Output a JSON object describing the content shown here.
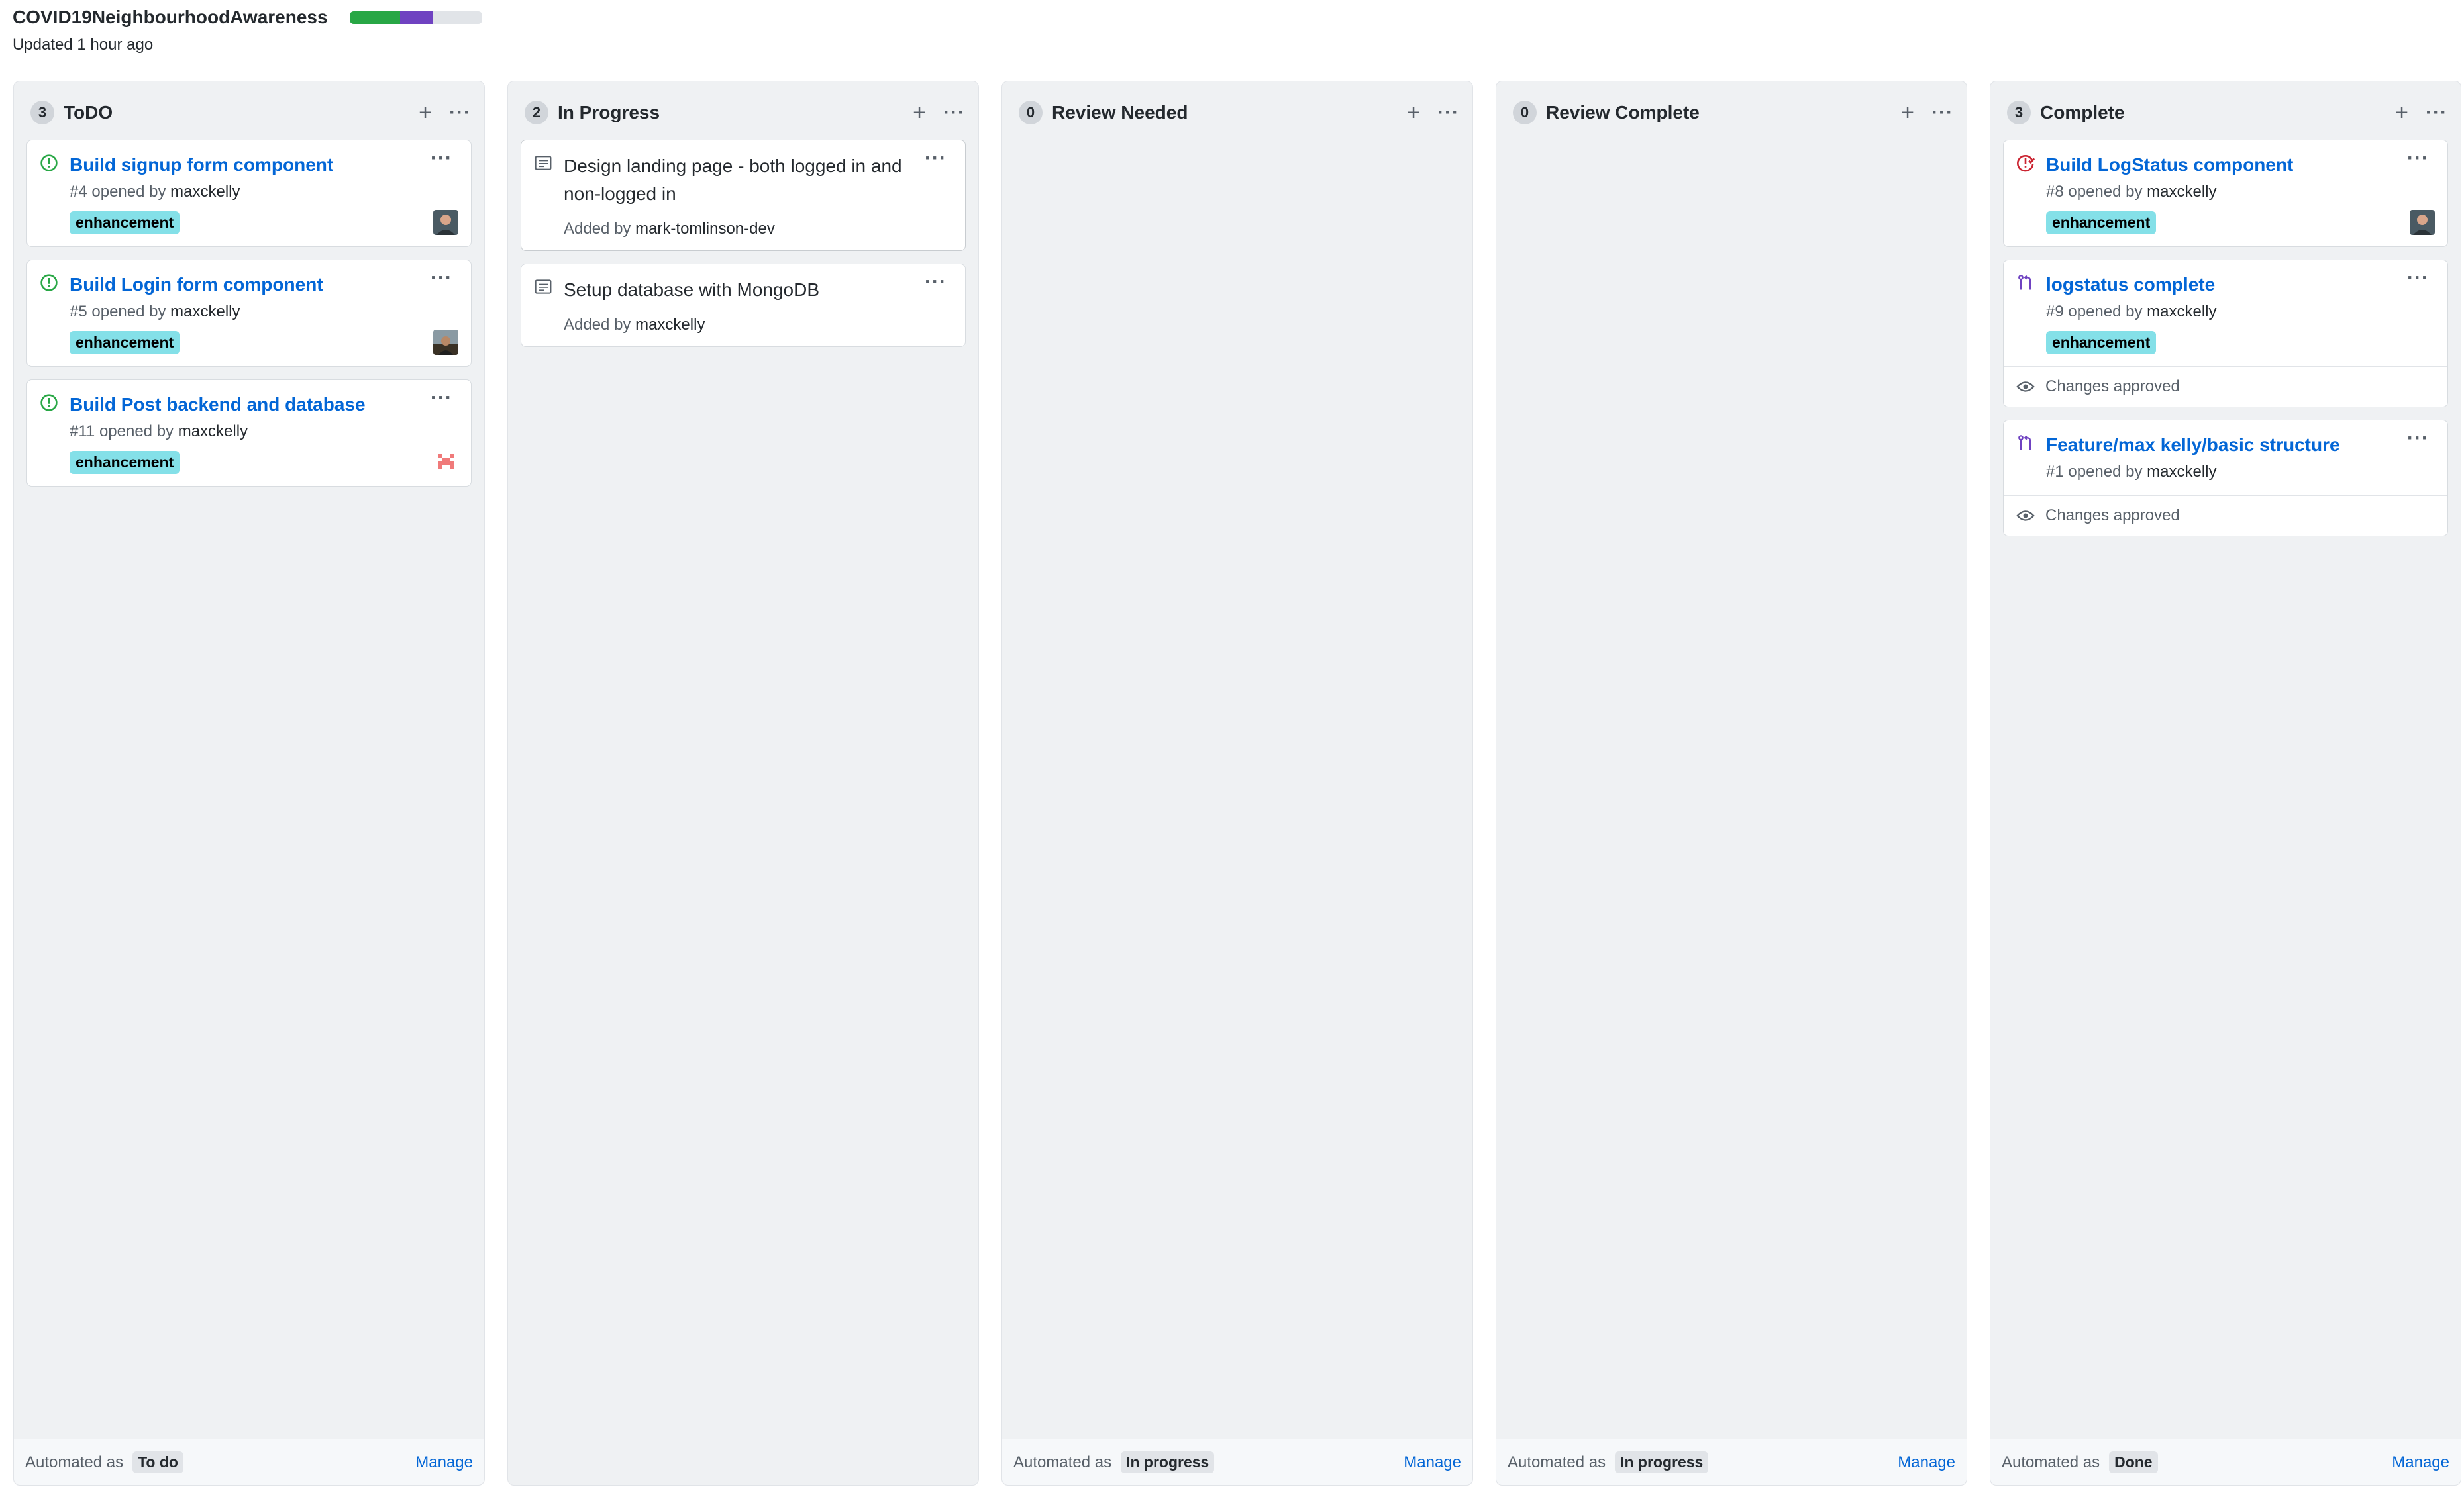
{
  "board": {
    "title": "COVID19NeighbourhoodAwareness",
    "updated": "Updated 1 hour ago",
    "progress": [
      {
        "color": "#28a745",
        "fraction": 0.38
      },
      {
        "color": "#6f42c1",
        "fraction": 0.25
      }
    ]
  },
  "colors": {
    "link": "#0366d6",
    "issue_open": "#28a745",
    "issue_closed": "#cb2431",
    "pr_merged": "#6f42c1",
    "label_bg": "#84e0e8"
  },
  "columns": [
    {
      "count": "3",
      "title": "ToDO",
      "automated_label": "Automated as",
      "automated_value": "To do",
      "manage": "Manage",
      "cards": [
        {
          "type": "issue-open",
          "icon": "issue-opened-icon",
          "title": "Build signup form component",
          "number": "#4",
          "opened_by": "opened by",
          "author": "maxckelly",
          "label": "enhancement",
          "avatar": "avatar-1"
        },
        {
          "type": "issue-open",
          "icon": "issue-opened-icon",
          "title": "Build Login form component",
          "number": "#5",
          "opened_by": "opened by",
          "author": "maxckelly",
          "label": "enhancement",
          "avatar": "avatar-2"
        },
        {
          "type": "issue-open",
          "icon": "issue-opened-icon",
          "title": "Build Post backend and database",
          "number": "#11",
          "opened_by": "opened by",
          "author": "maxckelly",
          "label": "enhancement",
          "avatar": "avatar-3"
        }
      ]
    },
    {
      "count": "2",
      "title": "In Progress",
      "automated_label": "",
      "automated_value": "",
      "manage": "",
      "cards": [
        {
          "type": "note",
          "icon": "note-icon",
          "text": "Design landing page - both logged in and non-logged in",
          "added_by": "Added by",
          "author": "mark-tomlinson-dev"
        },
        {
          "type": "note",
          "icon": "note-icon",
          "text": "Setup database with MongoDB",
          "added_by": "Added by",
          "author": "maxckelly"
        }
      ]
    },
    {
      "count": "0",
      "title": "Review Needed",
      "automated_label": "Automated as",
      "automated_value": "In progress",
      "manage": "Manage",
      "cards": []
    },
    {
      "count": "0",
      "title": "Review Complete",
      "automated_label": "Automated as",
      "automated_value": "In progress",
      "manage": "Manage",
      "cards": []
    },
    {
      "count": "3",
      "title": "Complete",
      "automated_label": "Automated as",
      "automated_value": "Done",
      "manage": "Manage",
      "cards": [
        {
          "type": "issue-closed",
          "icon": "issue-closed-icon",
          "title": "Build LogStatus component",
          "number": "#8",
          "opened_by": "opened by",
          "author": "maxckelly",
          "label": "enhancement",
          "avatar": "avatar-1"
        },
        {
          "type": "pr",
          "icon": "pull-request-icon",
          "title": "logstatus complete",
          "number": "#9",
          "opened_by": "opened by",
          "author": "maxckelly",
          "label": "enhancement",
          "review": "Changes approved"
        },
        {
          "type": "pr",
          "icon": "pull-request-icon",
          "title": "Feature/max kelly/basic structure",
          "number": "#1",
          "opened_by": "opened by",
          "author": "maxckelly",
          "review": "Changes approved"
        }
      ]
    }
  ]
}
